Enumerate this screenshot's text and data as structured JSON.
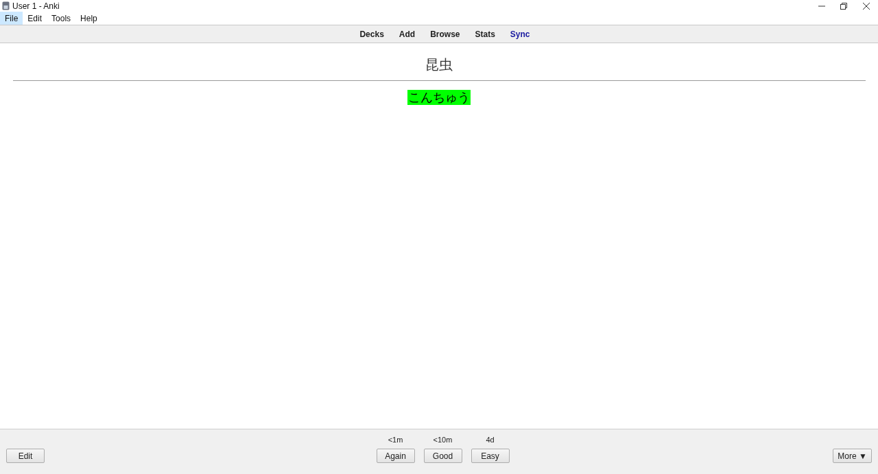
{
  "window": {
    "title": "User 1 - Anki"
  },
  "menu": [
    {
      "label": "File",
      "selected": true
    },
    {
      "label": "Edit",
      "selected": false
    },
    {
      "label": "Tools",
      "selected": false
    },
    {
      "label": "Help",
      "selected": false
    }
  ],
  "toolbar": [
    {
      "label": "Decks",
      "color": "#222222"
    },
    {
      "label": "Add",
      "color": "#222222"
    },
    {
      "label": "Browse",
      "color": "#222222"
    },
    {
      "label": "Stats",
      "color": "#222222"
    },
    {
      "label": "Sync",
      "color": "#1a1aa0"
    }
  ],
  "card": {
    "question": "昆虫",
    "answer": "こんちゅう"
  },
  "bottom": {
    "edit": "Edit",
    "answers": [
      {
        "time": "<1m",
        "label": "Again"
      },
      {
        "time": "<10m",
        "label": "Good"
      },
      {
        "time": "4d",
        "label": "Easy"
      }
    ],
    "more": "More ▼"
  }
}
